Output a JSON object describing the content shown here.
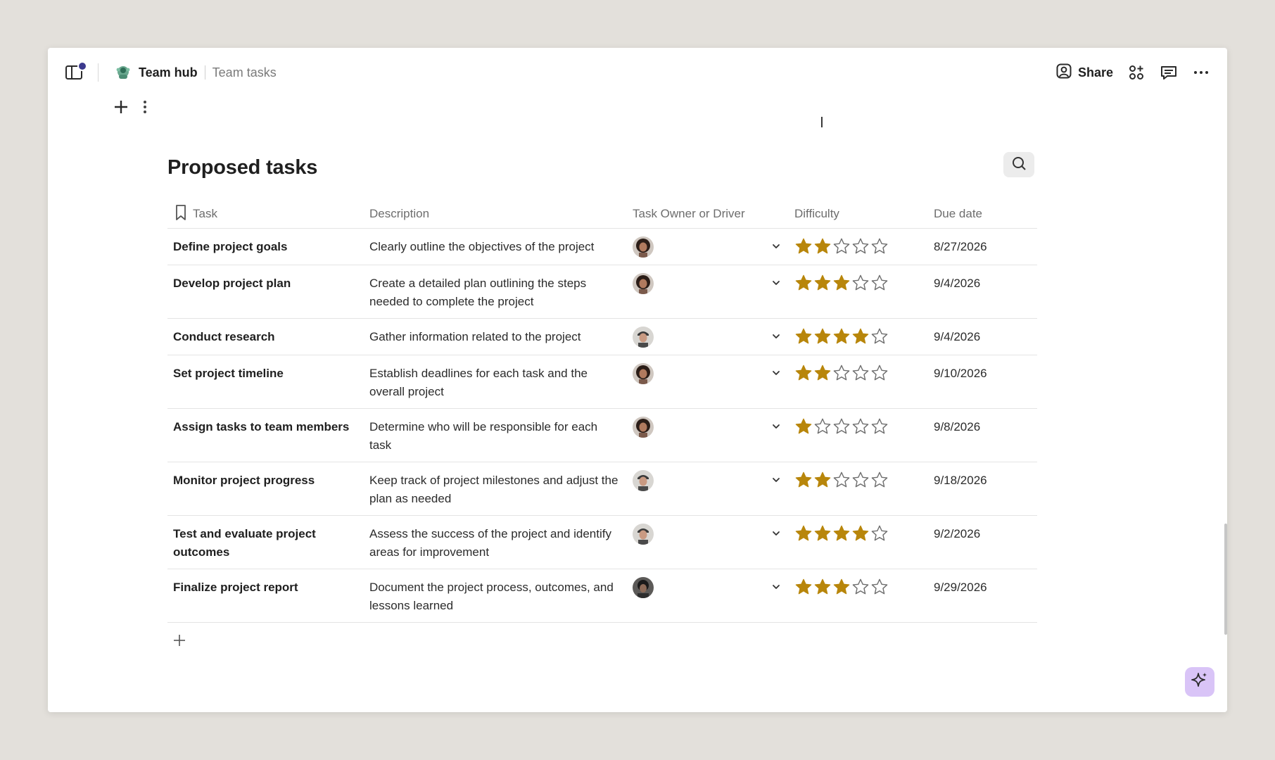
{
  "header": {
    "hub_name": "Team hub",
    "page_name": "Team tasks",
    "share_label": "Share"
  },
  "table": {
    "title": "Proposed tasks",
    "columns": [
      "Task",
      "Description",
      "Task Owner or Driver",
      "Difficulty",
      "Due date"
    ],
    "rows": [
      {
        "task": "Define project goals",
        "description": "Clearly outline the objectives of the project",
        "owner_avatar": "woman-curly",
        "difficulty": 2,
        "due": "8/27/2026"
      },
      {
        "task": "Develop project plan",
        "description": "Create a detailed plan outlining the steps needed to complete the project",
        "owner_avatar": "woman-curly",
        "difficulty": 3,
        "due": "9/4/2026"
      },
      {
        "task": "Conduct research",
        "description": "Gather information related to the project",
        "owner_avatar": "man-cap",
        "difficulty": 4,
        "due": "9/4/2026"
      },
      {
        "task": "Set project timeline",
        "description": "Establish deadlines for each task and the overall project",
        "owner_avatar": "woman-curly",
        "difficulty": 2,
        "due": "9/10/2026"
      },
      {
        "task": "Assign tasks to team members",
        "description": "Determine who will be responsible for each task",
        "owner_avatar": "woman-curly",
        "difficulty": 1,
        "due": "9/8/2026"
      },
      {
        "task": "Monitor project progress",
        "description": "Keep track of project milestones and adjust the plan as needed",
        "owner_avatar": "man-cap",
        "difficulty": 2,
        "due": "9/18/2026"
      },
      {
        "task": "Test and evaluate project outcomes",
        "description": "Assess the success of the project and identify areas for improvement",
        "owner_avatar": "man-cap",
        "difficulty": 4,
        "due": "9/2/2026"
      },
      {
        "task": "Finalize project report",
        "description": "Document the project process, outcomes, and lessons learned",
        "owner_avatar": "man-dark",
        "difficulty": 3,
        "due": "9/29/2026"
      }
    ]
  },
  "icons": {
    "sidebar": "sidebar-toggle-icon",
    "hub": "team-hub-icon",
    "share": "person-icon",
    "apps": "apps-icon",
    "comments": "comment-icon",
    "more": "more-horizontal-icon",
    "add": "plus-icon",
    "page_menu": "more-vertical-icon",
    "search": "search-icon",
    "bookmark": "bookmark-icon",
    "chevron": "chevron-down-icon",
    "star": "star-icon",
    "ai": "sparkle-icon"
  },
  "colors": {
    "star_filled": "#b8860b",
    "star_empty_stroke": "#6e6e6e",
    "notification_dot": "#3c3a8e",
    "ai_button": "#d9c4f7"
  }
}
